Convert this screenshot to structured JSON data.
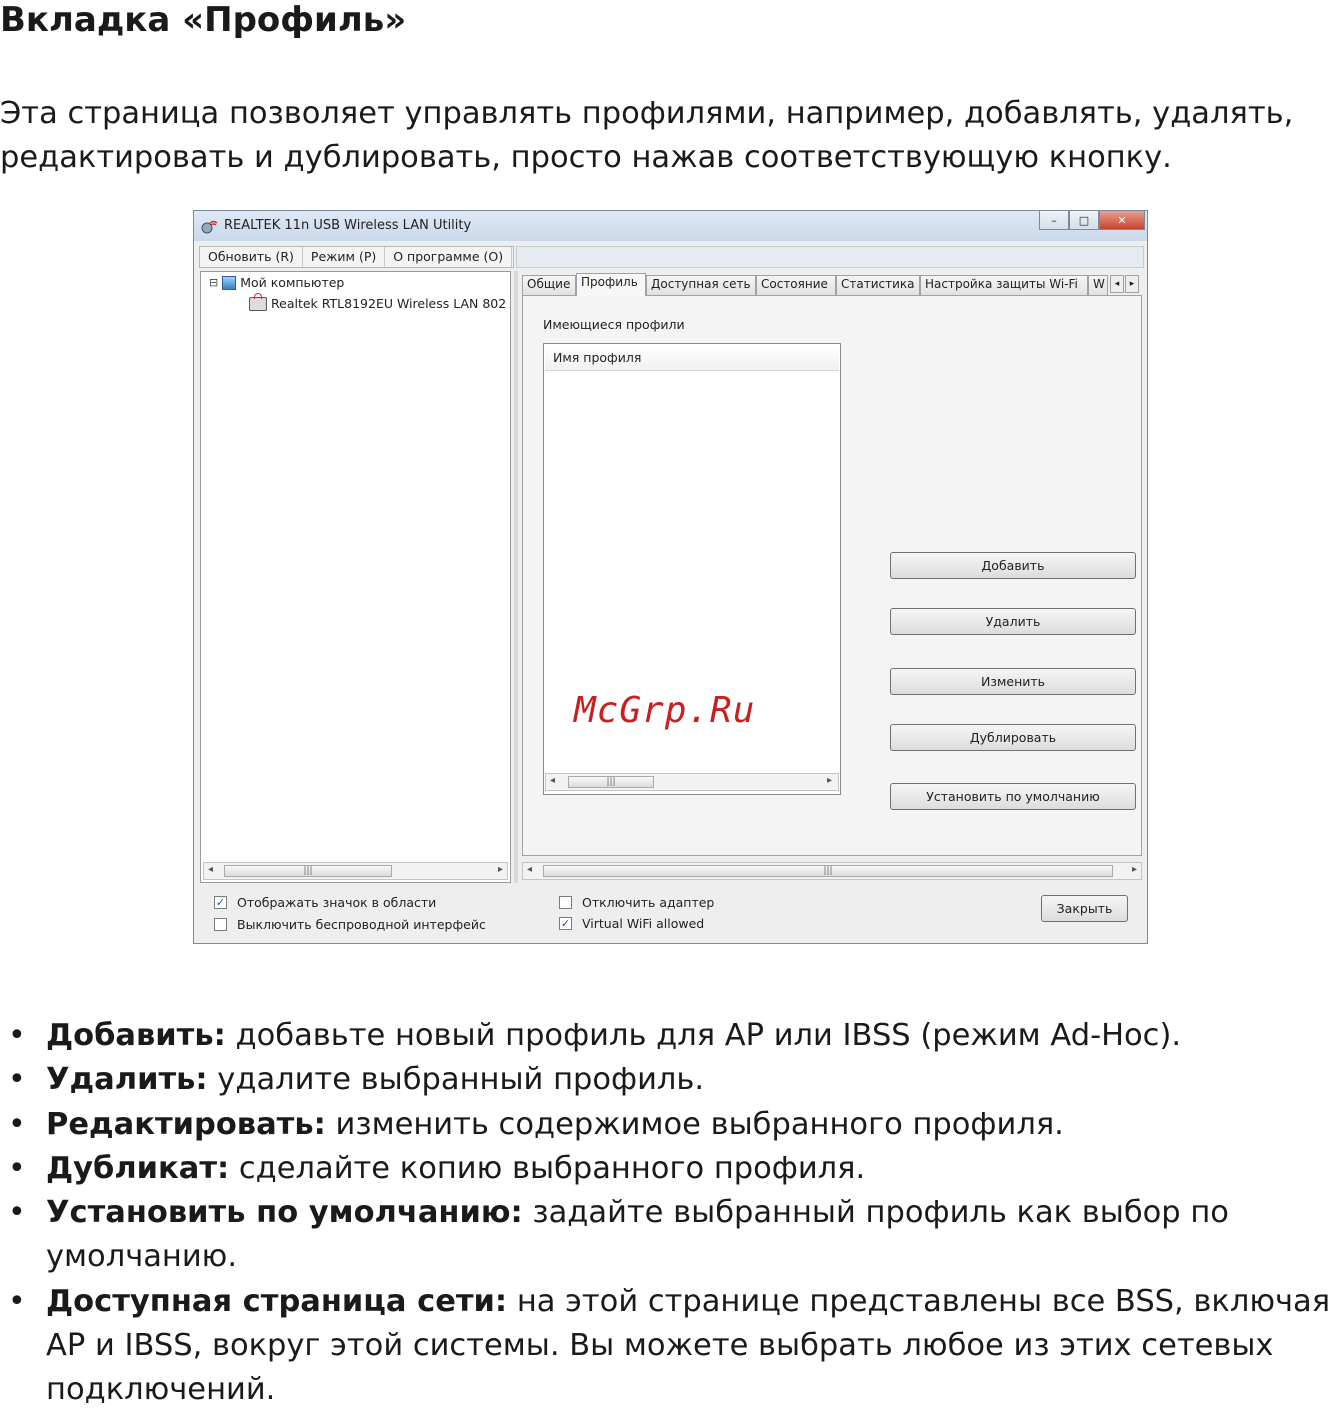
{
  "doc": {
    "title": "Вкладка «Профиль»",
    "intro_line1": "Эта страница позволяет управлять профилями, например, добавлять, удалять,",
    "intro_line2": "редактировать и дублировать, просто нажав соответствующую кнопку."
  },
  "window": {
    "title": "REALTEK 11n USB Wireless LAN Utility",
    "buttons": {
      "minimize": "–",
      "maximize": "□",
      "close": "✕"
    },
    "menu": [
      "Обновить (R)",
      "Режим (P)",
      "О программе (O)"
    ],
    "tree": {
      "root": "Мой компьютер",
      "child": "Realtek RTL8192EU Wireless LAN 802"
    },
    "tabs": [
      "Общие",
      "Профиль",
      "Доступная сеть",
      "Состояние",
      "Статистика",
      "Настройка защиты Wi-Fi",
      "W"
    ],
    "active_tab": "Профиль",
    "profile_tab": {
      "group_label": "Имеющиеся профили",
      "column_header": "Имя профиля",
      "buttons": [
        "Добавить",
        "Удалить",
        "Изменить",
        "Дублировать",
        "Установить по умолчанию"
      ]
    },
    "bottom": {
      "checkboxes": [
        {
          "label": "Отображать значок в области",
          "checked": true
        },
        {
          "label": "Выключить беспроводной интерфейс",
          "checked": false
        },
        {
          "label": "Отключить адаптер",
          "checked": false
        },
        {
          "label": "Virtual WiFi allowed",
          "checked": true
        }
      ],
      "close_button": "Закрыть"
    }
  },
  "watermark": "McGrp.Ru",
  "bullets": [
    {
      "term": "Добавить:",
      "text": " добавьте новый профиль для AP или IBSS (режим Ad-Hoc)."
    },
    {
      "term": "Удалить:",
      "text": " удалите выбранный профиль."
    },
    {
      "term": "Редактировать:",
      "text": " изменить содержимое выбранного профиля."
    },
    {
      "term": "Дубликат:",
      "text": " сделайте копию выбранного профиля."
    },
    {
      "term": "Установить по умолчанию:",
      "text": " задайте выбранный профиль как выбор по умолчанию."
    },
    {
      "term": "Доступная страница сети:",
      "text": " на этой странице представлены все BSS, включая AP и IBSS, вокруг этой системы. Вы можете выбрать любое из этих сетевых подключений."
    }
  ]
}
